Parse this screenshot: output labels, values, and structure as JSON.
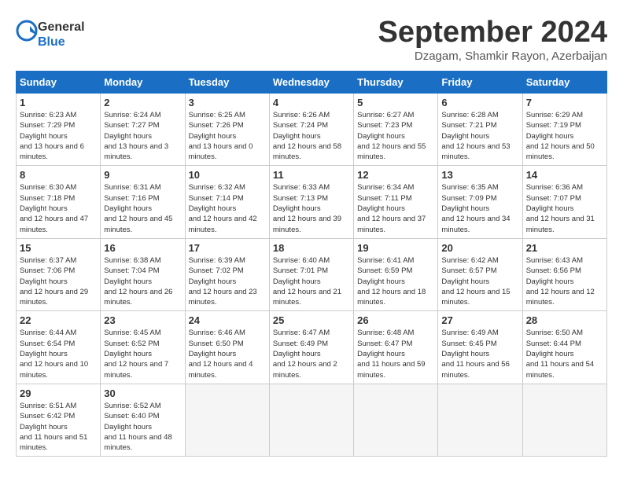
{
  "header": {
    "logo_line1": "General",
    "logo_line2": "Blue",
    "month_year": "September 2024",
    "location": "Dzagam, Shamkir Rayon, Azerbaijan"
  },
  "weekdays": [
    "Sunday",
    "Monday",
    "Tuesday",
    "Wednesday",
    "Thursday",
    "Friday",
    "Saturday"
  ],
  "weeks": [
    [
      {
        "day": "1",
        "sunrise": "6:23 AM",
        "sunset": "7:29 PM",
        "daylight": "13 hours and 6 minutes."
      },
      {
        "day": "2",
        "sunrise": "6:24 AM",
        "sunset": "7:27 PM",
        "daylight": "13 hours and 3 minutes."
      },
      {
        "day": "3",
        "sunrise": "6:25 AM",
        "sunset": "7:26 PM",
        "daylight": "13 hours and 0 minutes."
      },
      {
        "day": "4",
        "sunrise": "6:26 AM",
        "sunset": "7:24 PM",
        "daylight": "12 hours and 58 minutes."
      },
      {
        "day": "5",
        "sunrise": "6:27 AM",
        "sunset": "7:23 PM",
        "daylight": "12 hours and 55 minutes."
      },
      {
        "day": "6",
        "sunrise": "6:28 AM",
        "sunset": "7:21 PM",
        "daylight": "12 hours and 53 minutes."
      },
      {
        "day": "7",
        "sunrise": "6:29 AM",
        "sunset": "7:19 PM",
        "daylight": "12 hours and 50 minutes."
      }
    ],
    [
      {
        "day": "8",
        "sunrise": "6:30 AM",
        "sunset": "7:18 PM",
        "daylight": "12 hours and 47 minutes."
      },
      {
        "day": "9",
        "sunrise": "6:31 AM",
        "sunset": "7:16 PM",
        "daylight": "12 hours and 45 minutes."
      },
      {
        "day": "10",
        "sunrise": "6:32 AM",
        "sunset": "7:14 PM",
        "daylight": "12 hours and 42 minutes."
      },
      {
        "day": "11",
        "sunrise": "6:33 AM",
        "sunset": "7:13 PM",
        "daylight": "12 hours and 39 minutes."
      },
      {
        "day": "12",
        "sunrise": "6:34 AM",
        "sunset": "7:11 PM",
        "daylight": "12 hours and 37 minutes."
      },
      {
        "day": "13",
        "sunrise": "6:35 AM",
        "sunset": "7:09 PM",
        "daylight": "12 hours and 34 minutes."
      },
      {
        "day": "14",
        "sunrise": "6:36 AM",
        "sunset": "7:07 PM",
        "daylight": "12 hours and 31 minutes."
      }
    ],
    [
      {
        "day": "15",
        "sunrise": "6:37 AM",
        "sunset": "7:06 PM",
        "daylight": "12 hours and 29 minutes."
      },
      {
        "day": "16",
        "sunrise": "6:38 AM",
        "sunset": "7:04 PM",
        "daylight": "12 hours and 26 minutes."
      },
      {
        "day": "17",
        "sunrise": "6:39 AM",
        "sunset": "7:02 PM",
        "daylight": "12 hours and 23 minutes."
      },
      {
        "day": "18",
        "sunrise": "6:40 AM",
        "sunset": "7:01 PM",
        "daylight": "12 hours and 21 minutes."
      },
      {
        "day": "19",
        "sunrise": "6:41 AM",
        "sunset": "6:59 PM",
        "daylight": "12 hours and 18 minutes."
      },
      {
        "day": "20",
        "sunrise": "6:42 AM",
        "sunset": "6:57 PM",
        "daylight": "12 hours and 15 minutes."
      },
      {
        "day": "21",
        "sunrise": "6:43 AM",
        "sunset": "6:56 PM",
        "daylight": "12 hours and 12 minutes."
      }
    ],
    [
      {
        "day": "22",
        "sunrise": "6:44 AM",
        "sunset": "6:54 PM",
        "daylight": "12 hours and 10 minutes."
      },
      {
        "day": "23",
        "sunrise": "6:45 AM",
        "sunset": "6:52 PM",
        "daylight": "12 hours and 7 minutes."
      },
      {
        "day": "24",
        "sunrise": "6:46 AM",
        "sunset": "6:50 PM",
        "daylight": "12 hours and 4 minutes."
      },
      {
        "day": "25",
        "sunrise": "6:47 AM",
        "sunset": "6:49 PM",
        "daylight": "12 hours and 2 minutes."
      },
      {
        "day": "26",
        "sunrise": "6:48 AM",
        "sunset": "6:47 PM",
        "daylight": "11 hours and 59 minutes."
      },
      {
        "day": "27",
        "sunrise": "6:49 AM",
        "sunset": "6:45 PM",
        "daylight": "11 hours and 56 minutes."
      },
      {
        "day": "28",
        "sunrise": "6:50 AM",
        "sunset": "6:44 PM",
        "daylight": "11 hours and 54 minutes."
      }
    ],
    [
      {
        "day": "29",
        "sunrise": "6:51 AM",
        "sunset": "6:42 PM",
        "daylight": "11 hours and 51 minutes."
      },
      {
        "day": "30",
        "sunrise": "6:52 AM",
        "sunset": "6:40 PM",
        "daylight": "11 hours and 48 minutes."
      },
      null,
      null,
      null,
      null,
      null
    ]
  ]
}
